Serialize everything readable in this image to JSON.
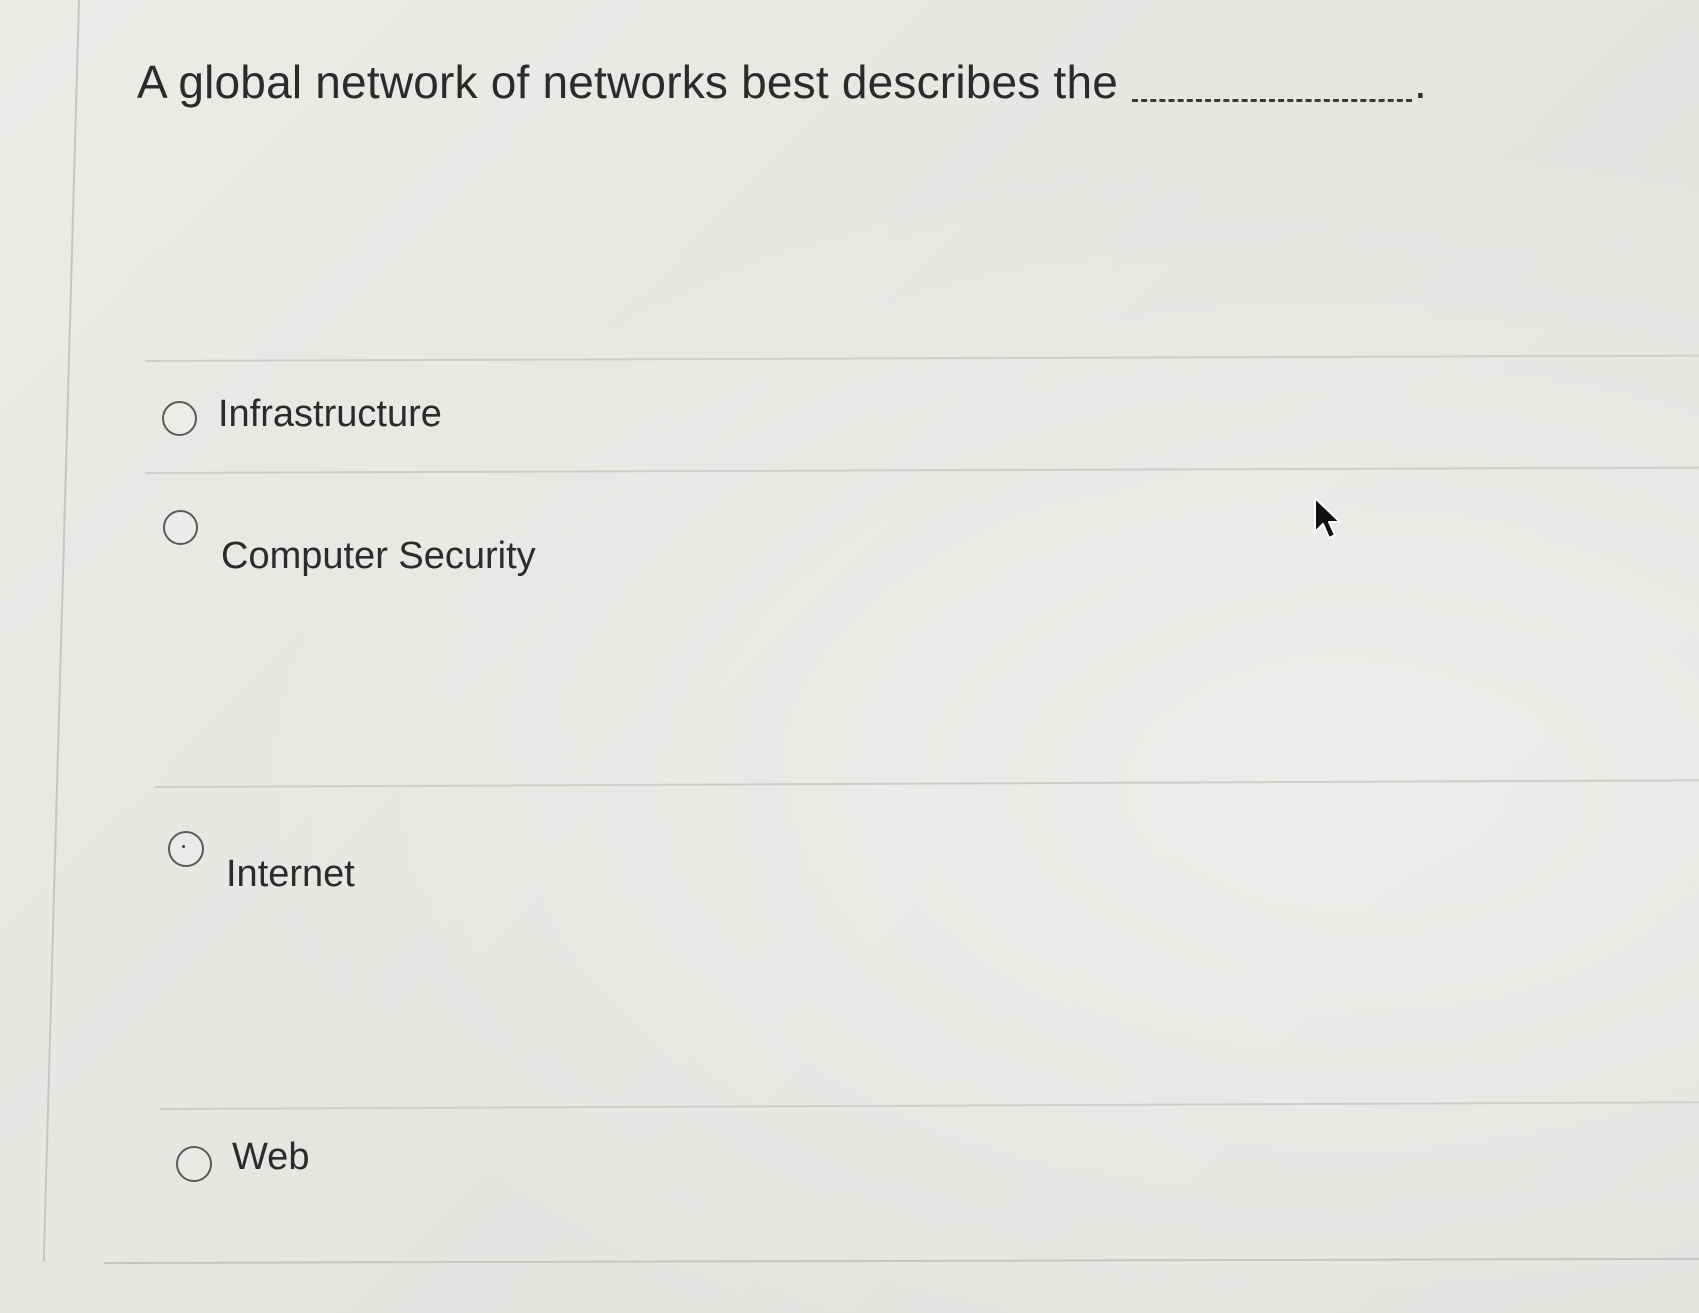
{
  "question": {
    "text": "A global network of networks best describes the",
    "period": "."
  },
  "options": [
    {
      "label": "Infrastructure",
      "selected": false
    },
    {
      "label": "Computer Security",
      "selected": false
    },
    {
      "label": "Internet",
      "selected": false
    },
    {
      "label": "Web",
      "selected": false
    }
  ],
  "icons": {
    "cursor": "mouse-pointer-icon",
    "radio": "radio-button-icon"
  },
  "colors": {
    "background": "#e9e8e5",
    "text": "#2b2b2b",
    "divider": "#cfcecb",
    "radio_border": "#5a5a5a"
  }
}
